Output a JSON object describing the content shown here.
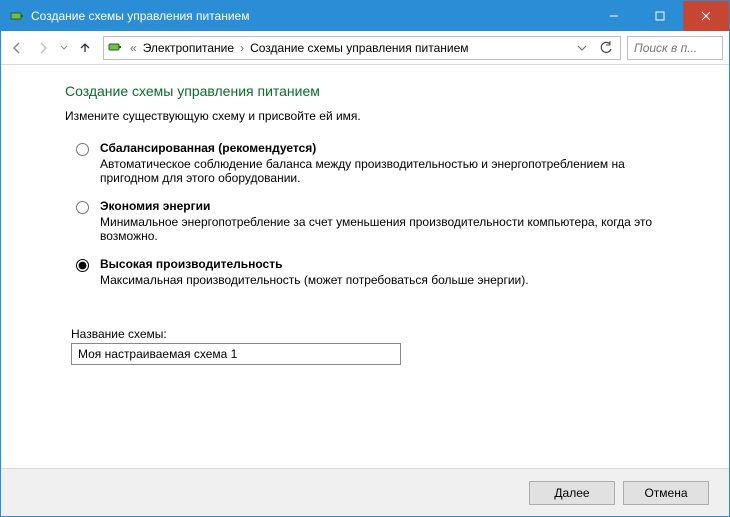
{
  "window": {
    "title": "Создание схемы управления питанием"
  },
  "nav": {
    "crumb_root": "Электропитание",
    "crumb_current": "Создание схемы управления питанием",
    "search_placeholder": "Поиск в п..."
  },
  "page": {
    "heading": "Создание схемы управления питанием",
    "instruction": "Измените существующую схему и присвойте ей имя."
  },
  "options": [
    {
      "id": "balanced",
      "label": "Сбалансированная (рекомендуется)",
      "desc": "Автоматическое соблюдение баланса между производительностью и энергопотреблением на пригодном для этого оборудовании.",
      "selected": false
    },
    {
      "id": "saver",
      "label": "Экономия энергии",
      "desc": "Минимальное энергопотребление за счет уменьшения производительности компьютера, когда это возможно.",
      "selected": false
    },
    {
      "id": "perf",
      "label": "Высокая производительность",
      "desc": "Максимальная производительность (может потребоваться больше энергии).",
      "selected": true
    }
  ],
  "plan_name": {
    "label": "Название схемы:",
    "value": "Моя настраиваемая схема 1"
  },
  "buttons": {
    "next": "Далее",
    "cancel": "Отмена"
  }
}
